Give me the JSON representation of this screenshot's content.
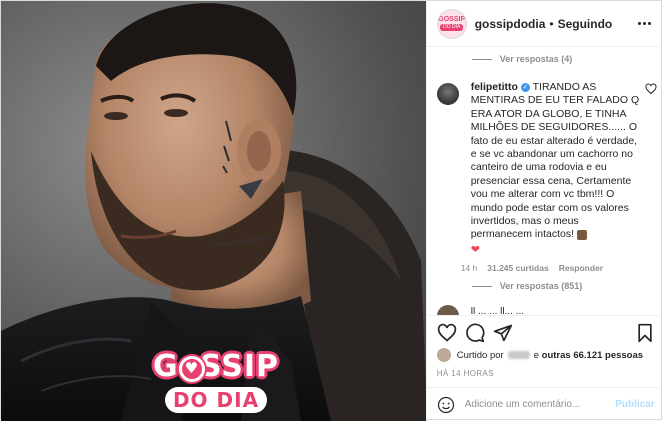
{
  "header": {
    "avatar_text_top": "GOSSIP",
    "avatar_text_bottom": "DO DIA",
    "username": "gossipdodia",
    "separator": "•",
    "follow_status": "Seguindo"
  },
  "comments": {
    "top_view_replies": "Ver respostas (4)",
    "main": {
      "username": "felipetitto",
      "text": "TIRANDO AS MENTIRAS DE EU TER FALADO Q ERA ATOR DA GLOBO, E TINHA MILHÕES DE SEGUIDORES...... O fato de eu estar alterado é verdade, e se vc abandonar um cachorro no canteiro de uma rodovia e eu presenciar essa cena, Certamente vou me alterar com vc tbm!!! O mundo pode estar com os valores invertidos, mas o meus permanecem intactos!",
      "heart": "❤",
      "time": "14 h",
      "likes": "31.245 curtidas",
      "reply_label": "Responder",
      "view_replies": "Ver respostas (851)"
    },
    "peek_text": "ll  ...   ... ll... ..."
  },
  "photo": {
    "neck_tattoo": "O mundo é de quem ..."
  },
  "logo": {
    "gossip_part1": "G",
    "gossip_part2": "SSIP",
    "dia": "DO DIA",
    "heart": "♥"
  },
  "likes": {
    "prefix": "Curtido por",
    "middle": "e",
    "others": "outras 66.121 pessoas"
  },
  "timestamp": "HÁ 14 HORAS",
  "add_comment": {
    "placeholder": "Adicione um comentário...",
    "publish_label": "Publicar"
  },
  "colors": {
    "brand_pink": "#e8416f",
    "verified_blue": "#3897f0",
    "publish_disabled": "#b2dffc"
  }
}
